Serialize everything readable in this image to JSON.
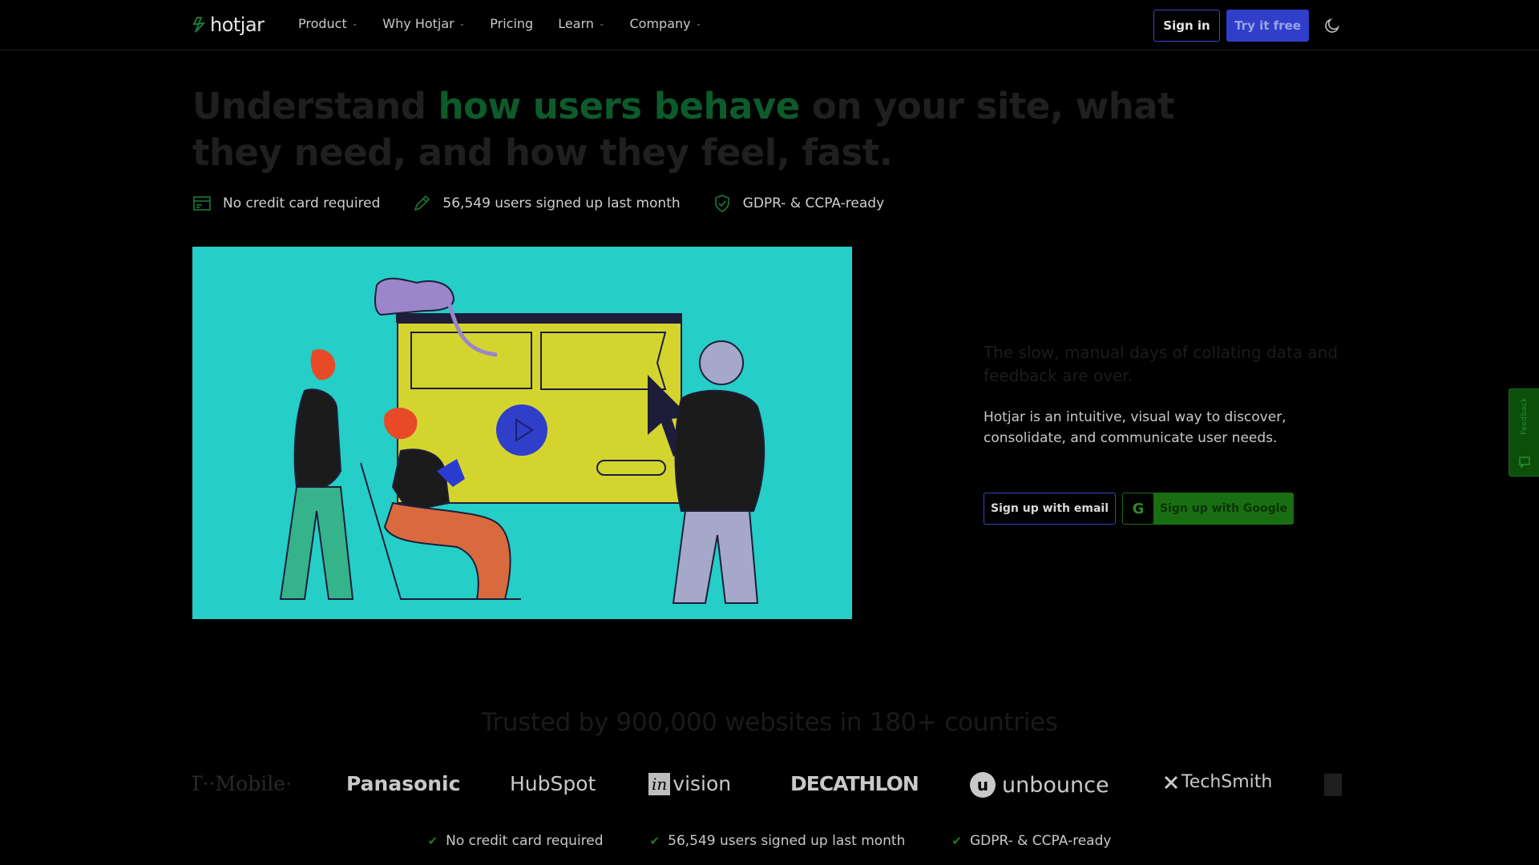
{
  "nav": {
    "logo": "hotjar",
    "links": [
      {
        "label": "Product",
        "has_dropdown": true
      },
      {
        "label": "Why Hotjar",
        "has_dropdown": true
      },
      {
        "label": "Pricing",
        "has_dropdown": false
      },
      {
        "label": "Learn",
        "has_dropdown": true
      },
      {
        "label": "Company",
        "has_dropdown": true
      }
    ],
    "signin_label": "Sign in",
    "try_label": "Try it free",
    "theme_icon": "moon-icon"
  },
  "hero": {
    "headline_part1": "Understand ",
    "headline_accent": "how users behave",
    "headline_part2": " on your site, what they need, and how they feel, fast.",
    "badges": [
      {
        "icon": "credit-card-icon",
        "label": "No credit card required"
      },
      {
        "icon": "pencil-icon",
        "label": "56,549 users signed up last month"
      },
      {
        "icon": "shield-check-icon",
        "label": "GDPR- & CCPA-ready"
      }
    ],
    "side_heading": "The slow, manual days of collating data and feedback are over.",
    "side_text": "Hotjar is an intuitive, visual way to discover, consolidate, and communicate user needs.",
    "email_button": "Sign up with email",
    "google_button": "Sign up with Google",
    "google_icon_letter": "G",
    "video_play_icon": "play-icon"
  },
  "feedback_tab": {
    "label": "Feedback"
  },
  "trust": {
    "heading": "Trusted by 900,000 websites in 180+ countries",
    "logos": [
      "T··Mobile·",
      "Panasonic",
      "HubSpot",
      "invision",
      "DECATHLON",
      "unbounce",
      "TechSmith"
    ],
    "invision_box": "in",
    "invision_rest": "vision",
    "unbounce_mark": "u"
  },
  "bottom_checks": [
    "No credit card required",
    "56,549 users signed up last month",
    "GDPR- & CCPA-ready"
  ],
  "colors": {
    "background": "#000000",
    "accent_green": "#0d5a2a",
    "primary_blue": "#2f3fc9",
    "google_green": "#1a6e12",
    "video_bg": "#25cec6"
  }
}
